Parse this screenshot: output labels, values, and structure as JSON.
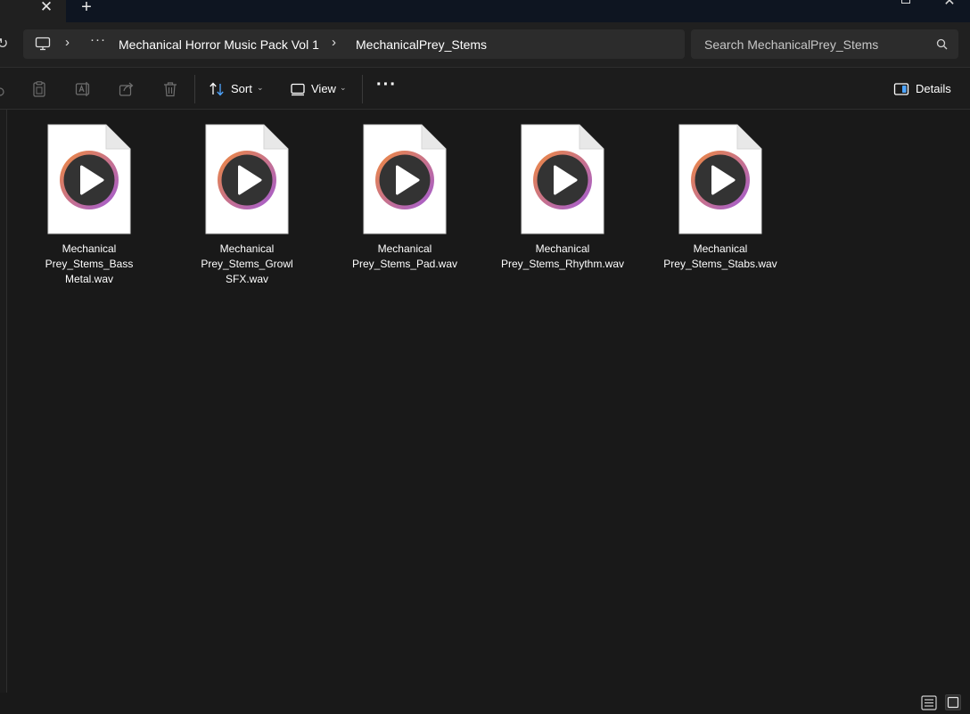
{
  "window": {
    "tab_close_glyph": "✕",
    "new_tab_glyph": "+",
    "close_glyph": "✕"
  },
  "address": {
    "separator": "›",
    "overflow": "···",
    "crumbs": [
      "Mechanical Horror Music Pack Vol 1",
      "MechanicalPrey_Stems"
    ]
  },
  "search": {
    "placeholder": "Search MechanicalPrey_Stems"
  },
  "toolbar": {
    "sort_label": "Sort",
    "view_label": "View",
    "more_glyph": "···",
    "details_label": "Details",
    "chevron": "⌄"
  },
  "files": [
    {
      "name": "Mechanical Prey_Stems_Bass Metal.wav"
    },
    {
      "name": "Mechanical Prey_Stems_Growl SFX.wav"
    },
    {
      "name": "Mechanical Prey_Stems_Pad.wav"
    },
    {
      "name": "Mechanical Prey_Stems_Rhythm.wav"
    },
    {
      "name": "Mechanical Prey_Stems_Stabs.wav"
    }
  ],
  "colors": {
    "accent": "#4ea5ff",
    "media_ring_start": "#f08a3c",
    "media_ring_end": "#a05ad8"
  },
  "icons": [
    "computer-icon",
    "search-icon",
    "copy-icon",
    "paste-icon",
    "rename-icon",
    "share-icon",
    "delete-icon",
    "sort-icon",
    "view-icon",
    "details-pane-icon",
    "media-file-icon",
    "details-view-icon",
    "tiles-view-icon"
  ]
}
